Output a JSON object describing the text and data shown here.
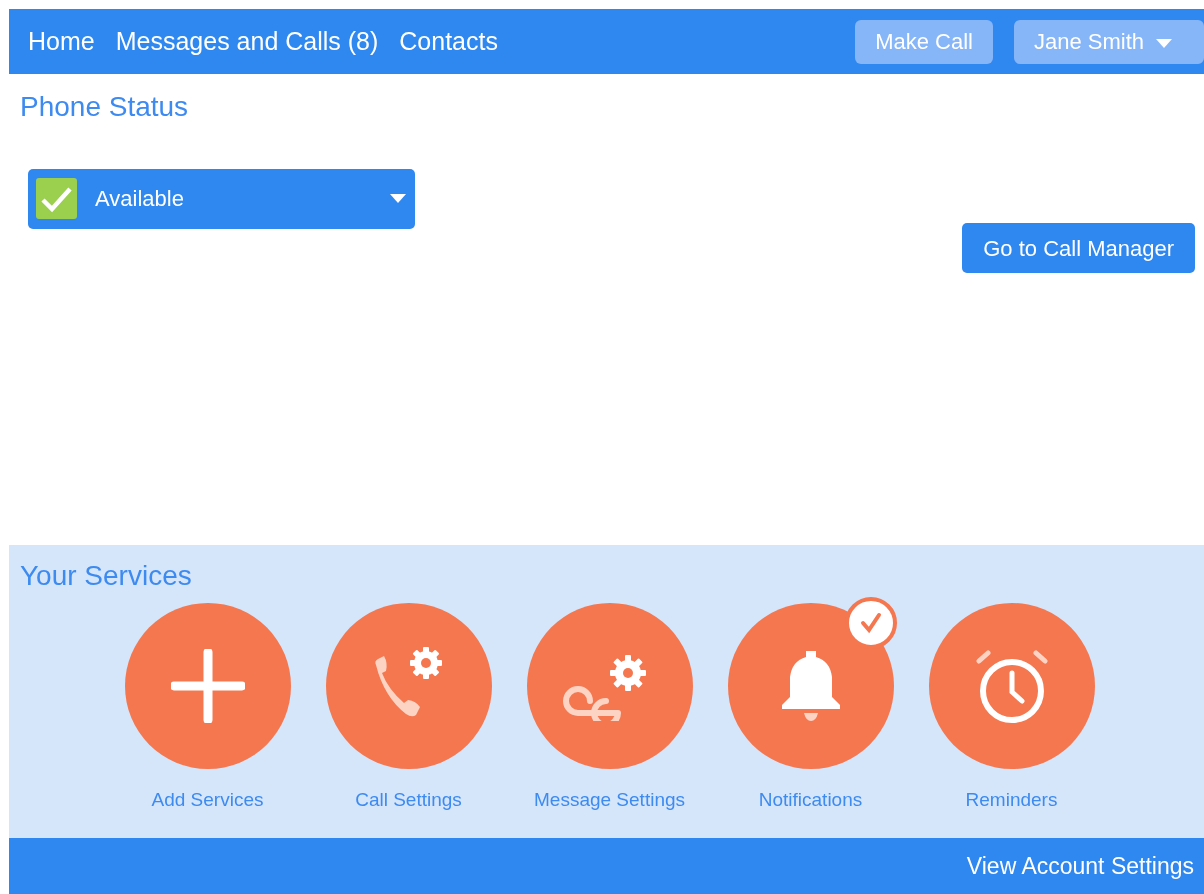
{
  "navbar": {
    "links": [
      "Home",
      "Messages and Calls (8)",
      "Contacts"
    ],
    "make_call": "Make Call",
    "user": "Jane Smith"
  },
  "phone_status": {
    "title": "Phone Status",
    "status": "Available",
    "call_manager": "Go to Call Manager"
  },
  "services": {
    "title": "Your Services",
    "items": [
      {
        "kind": "add",
        "label": "Add Services",
        "checked": false
      },
      {
        "kind": "call",
        "label": "Call Settings",
        "checked": false
      },
      {
        "kind": "message",
        "label": "Message Settings",
        "checked": false
      },
      {
        "kind": "bell",
        "label": "Notifications",
        "checked": true
      },
      {
        "kind": "alarm",
        "label": "Reminders",
        "checked": false
      }
    ]
  },
  "footer": {
    "link": "View Account Settings"
  }
}
